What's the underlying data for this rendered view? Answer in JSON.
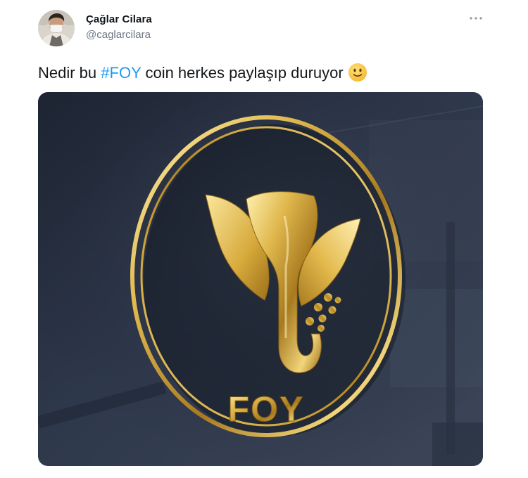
{
  "tweet": {
    "author": {
      "display_name": "Çağlar Cilara",
      "handle": "@caglarcilara"
    },
    "text": {
      "before_hashtag": "Nedir bu ",
      "hashtag": "#FOY",
      "after_hashtag": " coin herkes paylaşıp duruyor"
    },
    "emoji": "slightly-smiling-face",
    "media": {
      "logo_text": "FOY"
    }
  },
  "icons": {
    "more": "more-horizontal-icon"
  },
  "colors": {
    "hashtag": "#1d9bf0",
    "handle": "#6a7681",
    "text": "#14171a",
    "gold": "#d9b14a",
    "wall": "#2b3547"
  }
}
